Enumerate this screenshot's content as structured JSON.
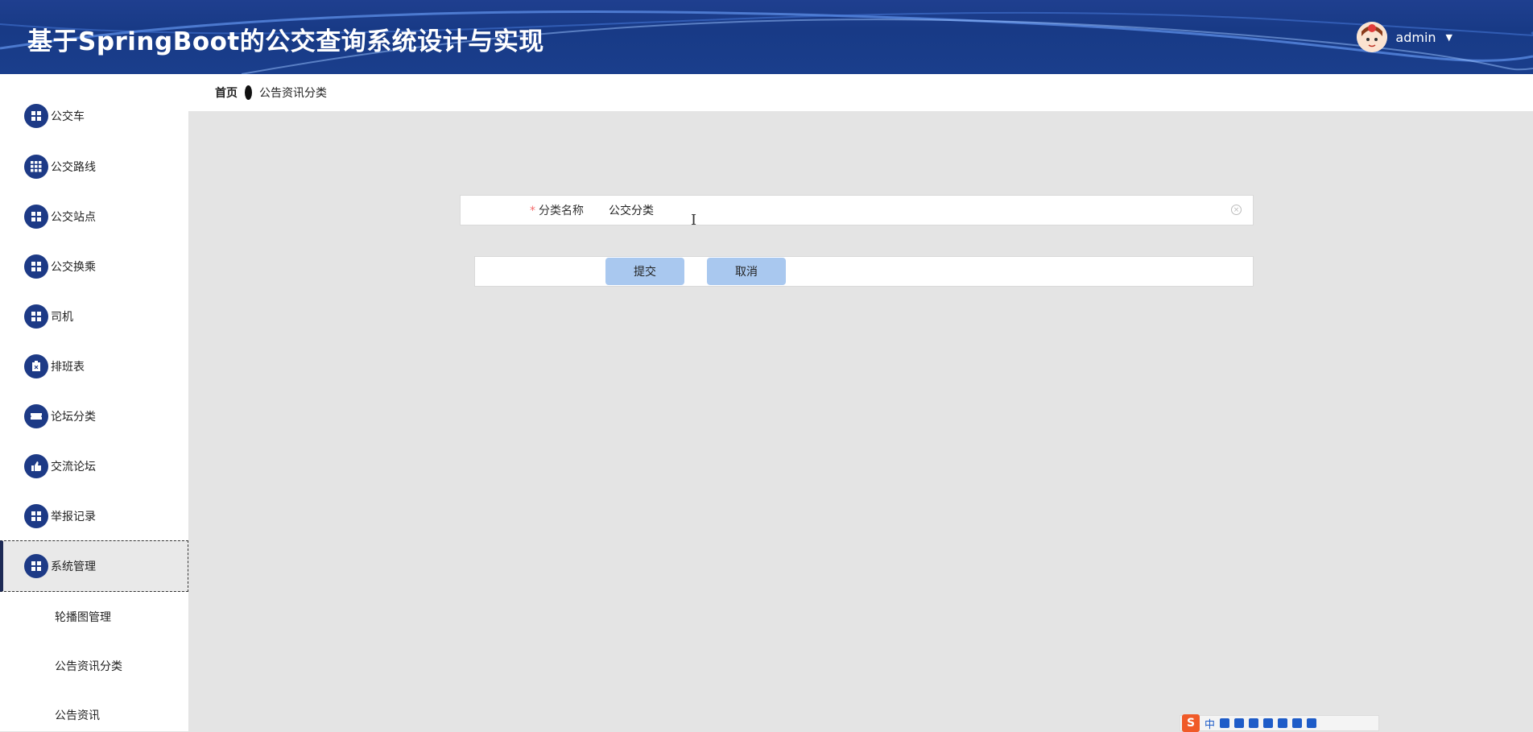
{
  "header": {
    "title": "基于SpringBoot的公交查询系统设计与实现",
    "user_name": "admin"
  },
  "breadcrumb": {
    "home": "首页",
    "current": "公告资讯分类"
  },
  "sidebar": {
    "items": [
      {
        "label": "公交车",
        "icon": "grid-icon"
      },
      {
        "label": "公交路线",
        "icon": "apps-icon"
      },
      {
        "label": "公交站点",
        "icon": "grid-icon"
      },
      {
        "label": "公交换乘",
        "icon": "grid-icon"
      },
      {
        "label": "司机",
        "icon": "grid-icon"
      },
      {
        "label": "排班表",
        "icon": "clipboard-icon"
      },
      {
        "label": "论坛分类",
        "icon": "ticket-icon"
      },
      {
        "label": "交流论坛",
        "icon": "thumb-icon"
      },
      {
        "label": "举报记录",
        "icon": "grid-icon"
      },
      {
        "label": "系统管理",
        "icon": "grid-icon",
        "active": true
      }
    ],
    "sub_items": [
      {
        "label": "轮播图管理"
      },
      {
        "label": "公告资讯分类"
      },
      {
        "label": "公告资讯"
      }
    ]
  },
  "form": {
    "field_label": "分类名称",
    "required_mark": "*",
    "field_value": "公交分类",
    "submit_label": "提交",
    "cancel_label": "取消"
  },
  "ime_toolbar": {
    "mode": "中"
  },
  "colors": {
    "header_bg": "#1f3f8f",
    "menu_icon_bg": "#1d3a86",
    "button_bg": "#a9c8ef",
    "content_bg": "#e4e4e4"
  }
}
